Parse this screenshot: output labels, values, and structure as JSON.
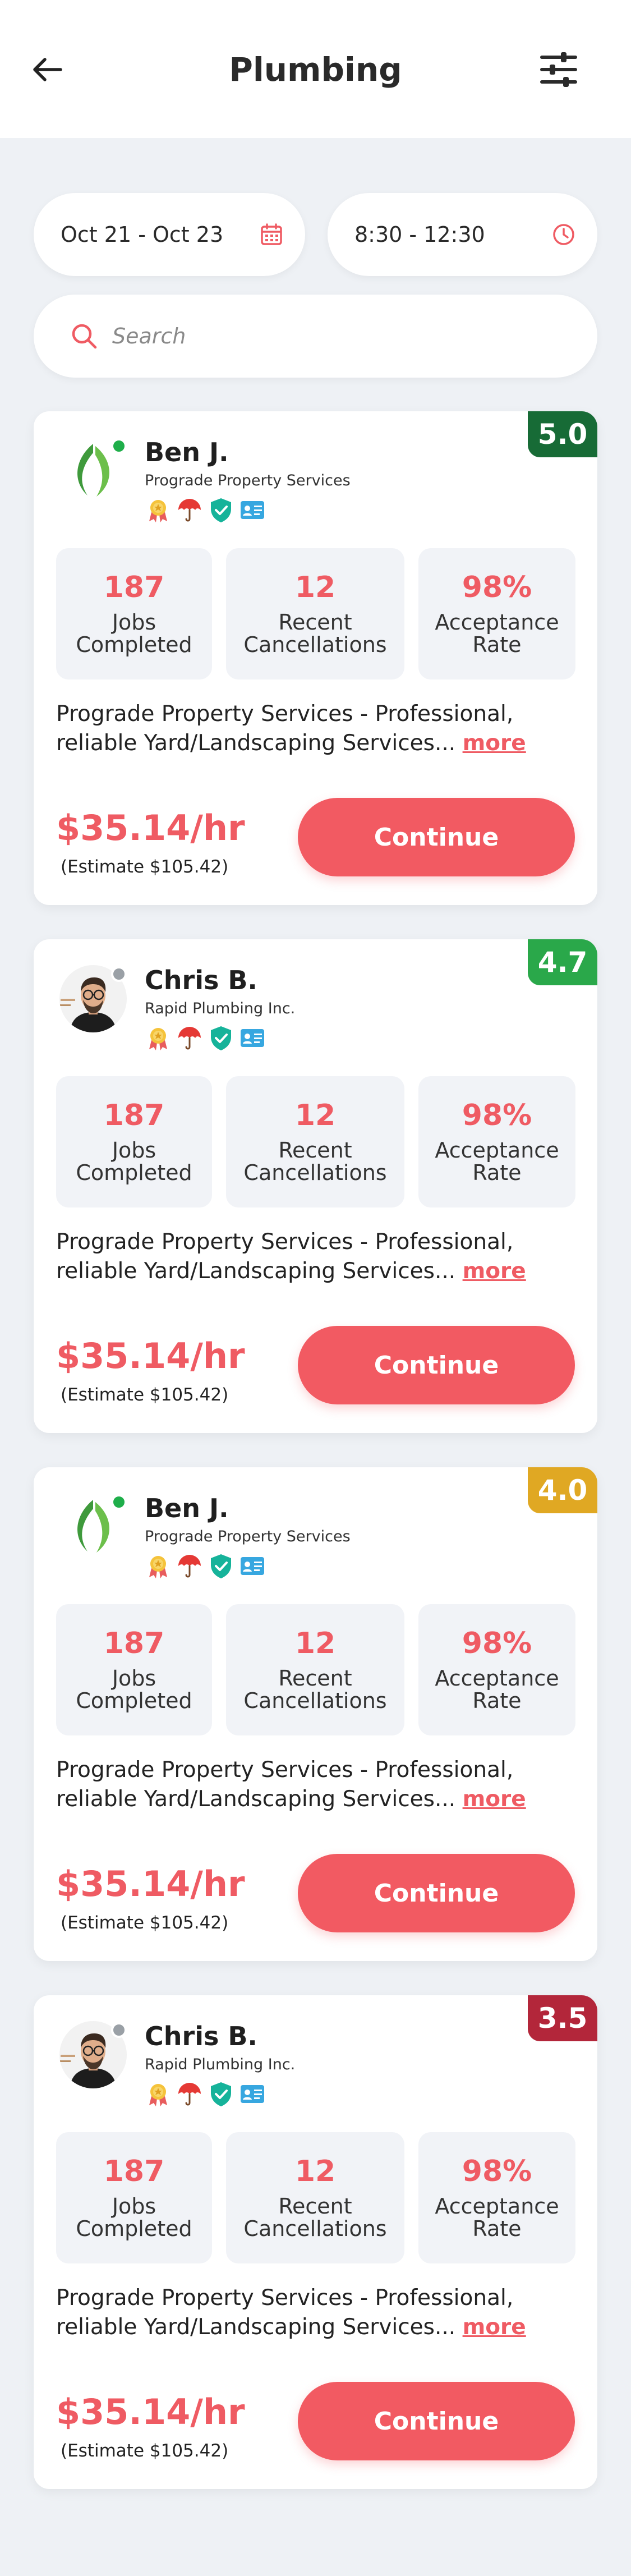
{
  "header": {
    "title": "Plumbing"
  },
  "filters": {
    "date_range": "Oct 21 - Oct 23",
    "time_range": "8:30 - 12:30"
  },
  "search": {
    "placeholder": "Search",
    "value": ""
  },
  "colors": {
    "accent": "#ef5b63",
    "online": "#1fae4a",
    "offline": "#9aa0a6"
  },
  "cards": [
    {
      "name": "Ben J.",
      "company": "Prograde Property Services",
      "rating": "5.0",
      "rating_color": "#176b36",
      "avatar": "leaf-logo",
      "status": "online",
      "badges": [
        "medal-icon",
        "umbrella-icon",
        "shield-check-icon",
        "id-card-icon"
      ],
      "stats": [
        {
          "value": "187",
          "label": "Jobs Completed"
        },
        {
          "value": "12",
          "label": "Recent Cancellations"
        },
        {
          "value": "98%",
          "label": "Acceptance Rate"
        }
      ],
      "description": "Prograde Property Services - Professional, reliable Yard/Landscaping Services...",
      "more_label": "more",
      "price": "$35.14/hr",
      "estimate": "(Estimate $105.42)",
      "button_label": "Continue"
    },
    {
      "name": "Chris B.",
      "company": "Rapid Plumbing Inc.",
      "rating": "4.7",
      "rating_color": "#2aa84a",
      "avatar": "man-portrait",
      "status": "offline",
      "badges": [
        "medal-icon",
        "umbrella-icon",
        "shield-check-icon",
        "id-card-icon"
      ],
      "stats": [
        {
          "value": "187",
          "label": "Jobs Completed"
        },
        {
          "value": "12",
          "label": "Recent Cancellations"
        },
        {
          "value": "98%",
          "label": "Acceptance Rate"
        }
      ],
      "description": "Prograde Property Services - Professional, reliable Yard/Landscaping Services...",
      "more_label": "more",
      "price": "$35.14/hr",
      "estimate": "(Estimate $105.42)",
      "button_label": "Continue"
    },
    {
      "name": "Ben J.",
      "company": "Prograde Property Services",
      "rating": "4.0",
      "rating_color": "#e0a823",
      "avatar": "leaf-logo",
      "status": "online",
      "badges": [
        "medal-icon",
        "umbrella-icon",
        "shield-check-icon",
        "id-card-icon"
      ],
      "stats": [
        {
          "value": "187",
          "label": "Jobs Completed"
        },
        {
          "value": "12",
          "label": "Recent Cancellations"
        },
        {
          "value": "98%",
          "label": "Acceptance Rate"
        }
      ],
      "description": "Prograde Property Services - Professional, reliable Yard/Landscaping Services...",
      "more_label": "more",
      "price": "$35.14/hr",
      "estimate": "(Estimate $105.42)",
      "button_label": "Continue"
    },
    {
      "name": "Chris B.",
      "company": "Rapid Plumbing Inc.",
      "rating": "3.5",
      "rating_color": "#b3263a",
      "avatar": "man-portrait",
      "status": "offline",
      "badges": [
        "medal-icon",
        "umbrella-icon",
        "shield-check-icon",
        "id-card-icon"
      ],
      "stats": [
        {
          "value": "187",
          "label": "Jobs Completed"
        },
        {
          "value": "12",
          "label": "Recent Cancellations"
        },
        {
          "value": "98%",
          "label": "Acceptance Rate"
        }
      ],
      "description": "Prograde Property Services - Professional, reliable Yard/Landscaping Services...",
      "more_label": "more",
      "price": "$35.14/hr",
      "estimate": "(Estimate $105.42)",
      "button_label": "Continue"
    }
  ]
}
